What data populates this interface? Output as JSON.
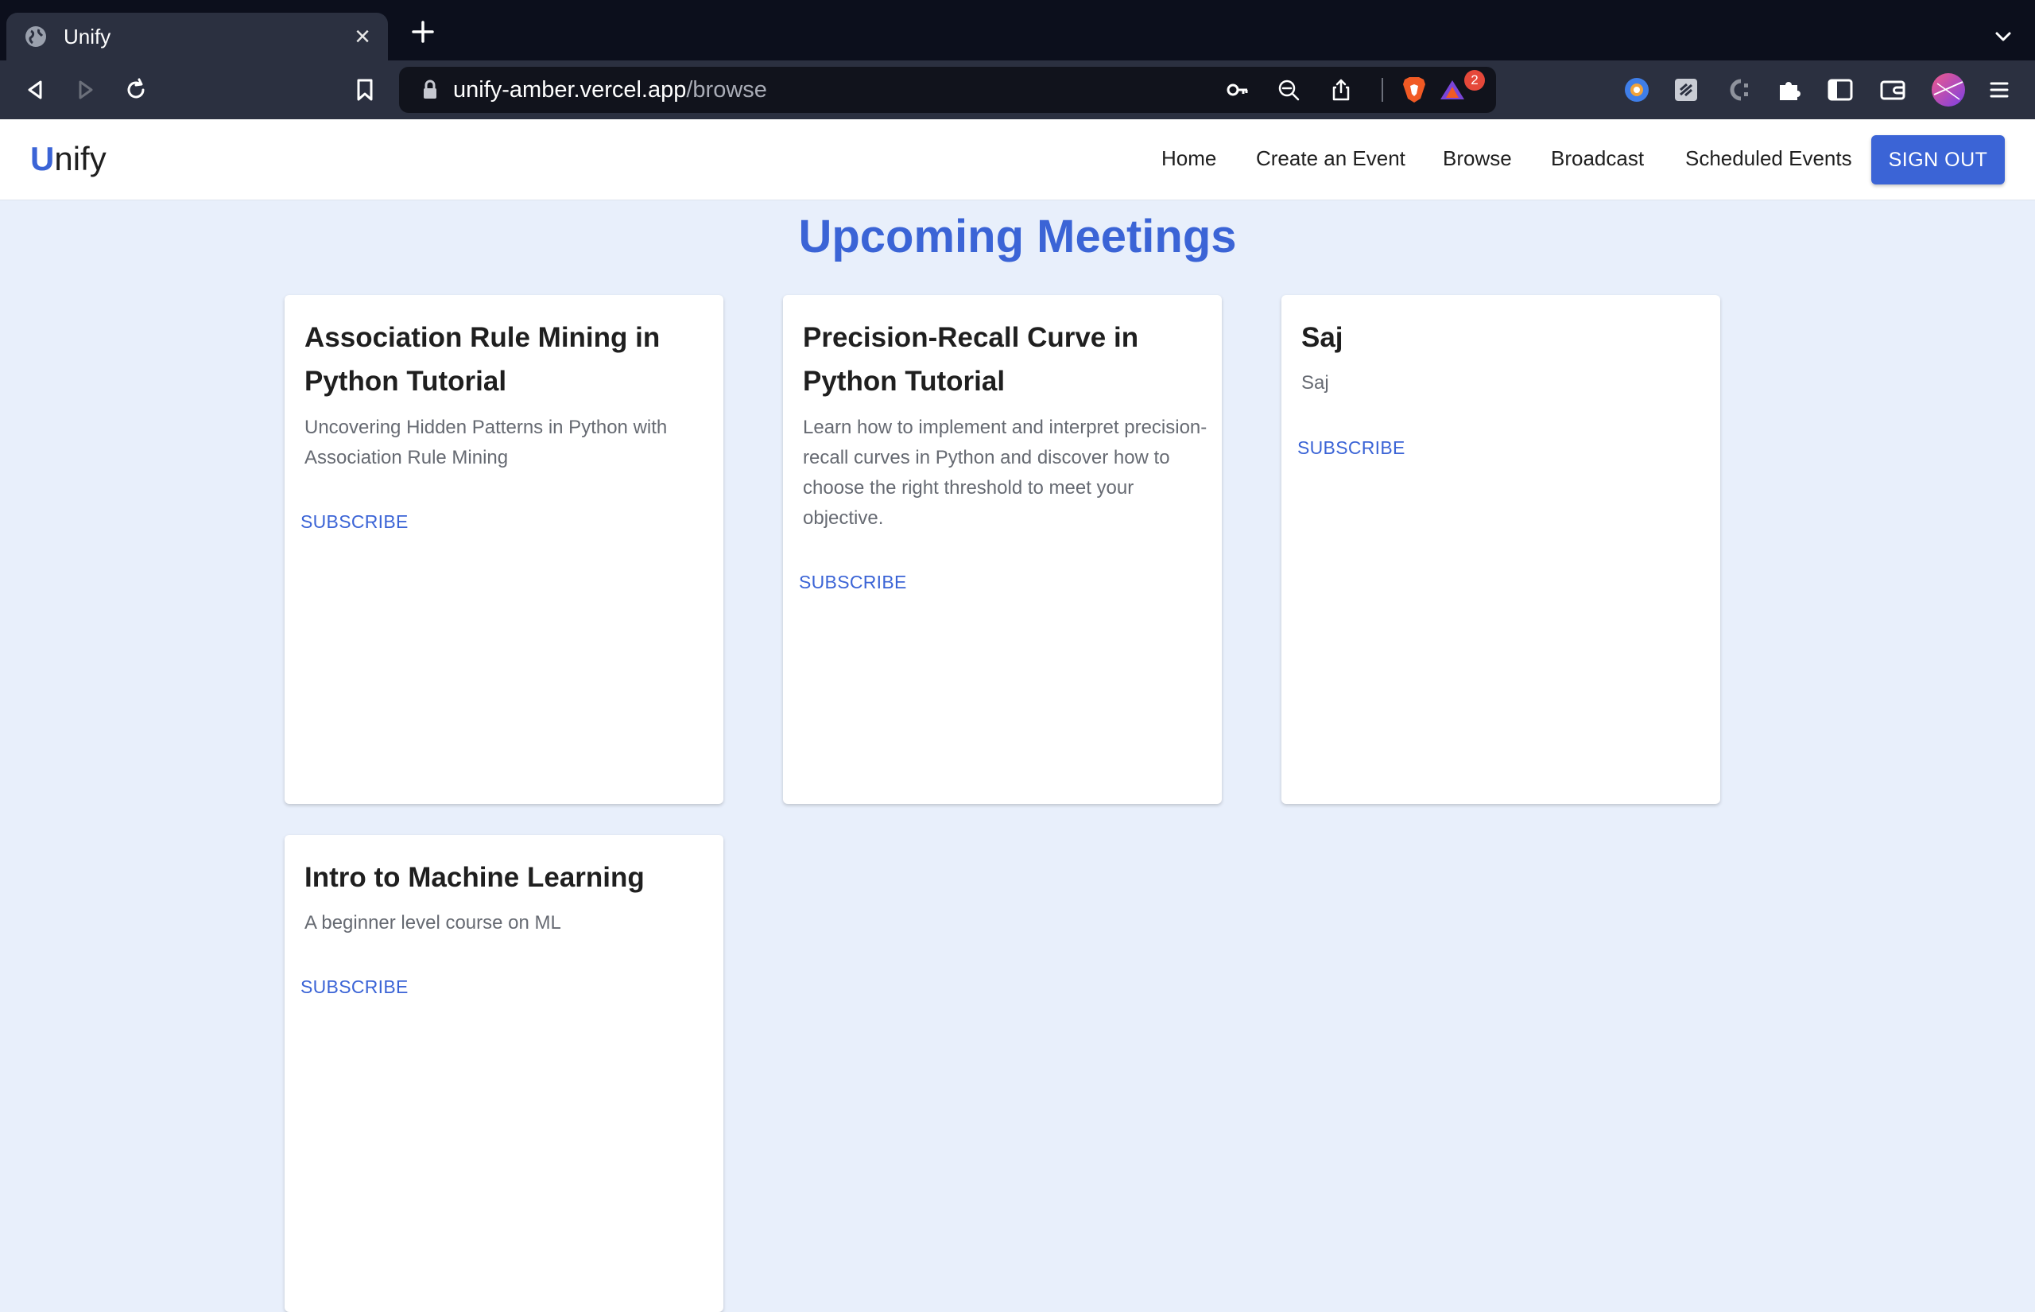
{
  "browser": {
    "tab_title": "Unify",
    "url_domain": "unify-amber.vercel.app",
    "url_path": "/browse",
    "notification_count": "2"
  },
  "header": {
    "logo_letter": "U",
    "logo_rest": "nify",
    "nav": {
      "home": "Home",
      "create_event": "Create an Event",
      "browse": "Browse",
      "broadcast": "Broadcast",
      "scheduled_events": "Scheduled Events"
    },
    "sign_out": "SIGN OUT"
  },
  "main": {
    "title": "Upcoming Meetings",
    "cards": [
      {
        "title": "Association Rule Mining in Python Tutorial",
        "description": "Uncovering Hidden Patterns in Python with Association Rule Mining",
        "action": "SUBSCRIBE"
      },
      {
        "title": "Precision-Recall Curve in Python Tutorial",
        "description": "Learn how to implement and interpret precision-recall curves in Python and discover how to choose the right threshold to meet your objective.",
        "action": "SUBSCRIBE"
      },
      {
        "title": "Saj",
        "description": "Saj",
        "action": "SUBSCRIBE"
      },
      {
        "title": "Intro to Machine Learning",
        "description": "A beginner level course on ML",
        "action": "SUBSCRIBE"
      }
    ]
  },
  "colors": {
    "accent": "#3b64d6",
    "page_background": "#e8effb",
    "chrome_dark": "#0c0f1c",
    "chrome_toolbar": "#2b3040"
  }
}
